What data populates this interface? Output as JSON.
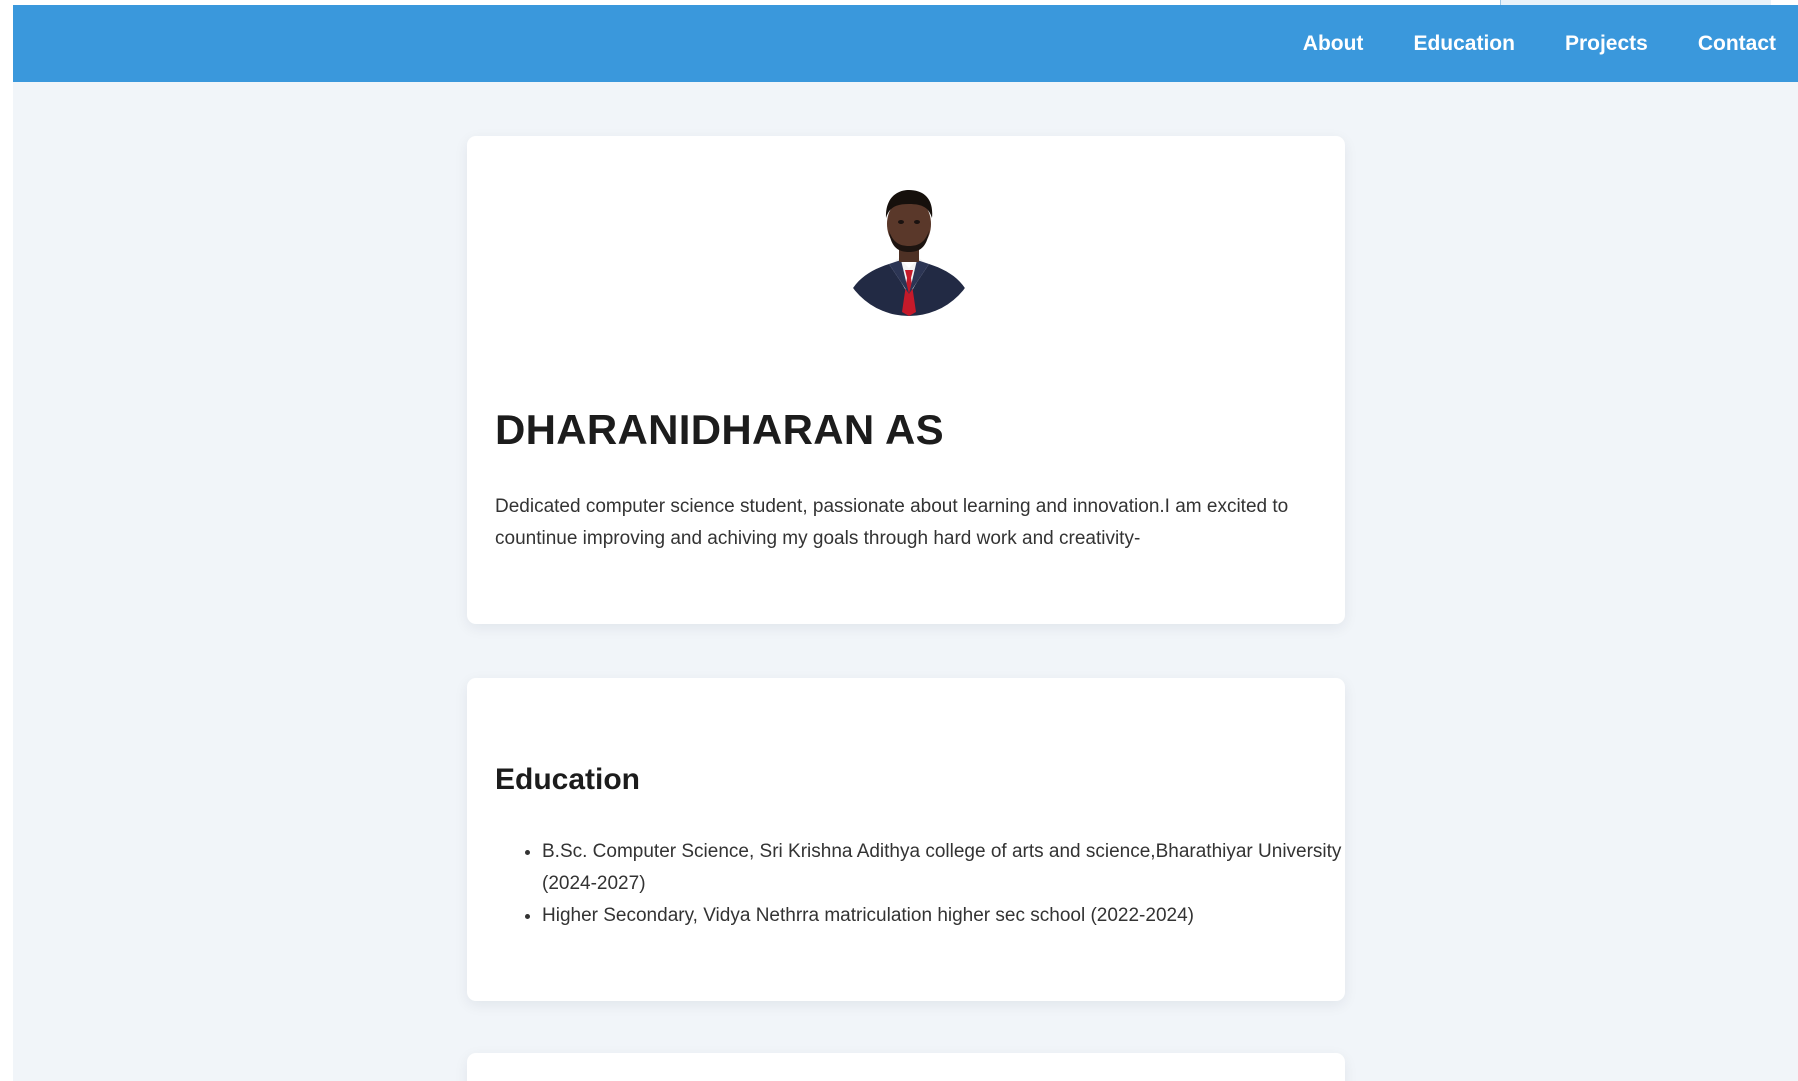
{
  "nav": {
    "items": [
      {
        "label": "About"
      },
      {
        "label": "Education"
      },
      {
        "label": "Projects"
      },
      {
        "label": "Contact"
      }
    ]
  },
  "profile": {
    "name": "DHARANIDHARAN AS",
    "bio": "Dedicated computer science student, passionate about learning and innovation.I am excited to countinue improving and achiving my goals through hard work and creativity-"
  },
  "education": {
    "title": "Education",
    "items": [
      {
        "text": "B.Sc. Computer Science, Sri Krishna Adithya college of arts and science,Bharathiyar University (2024-2027)"
      },
      {
        "text": "Higher Secondary, Vidya Nethrra matriculation higher sec school (2022-2024)"
      }
    ]
  },
  "colors": {
    "navbar": "#3a98dc",
    "page_background": "#f1f5f9",
    "card": "#ffffff",
    "text": "#1c1c1c"
  }
}
